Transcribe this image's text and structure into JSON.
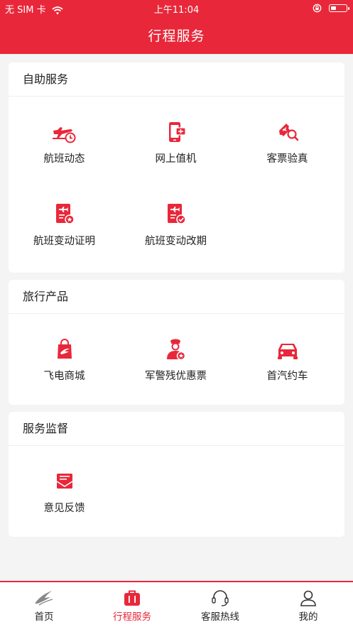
{
  "status_bar": {
    "carrier": "无 SIM 卡",
    "time": "上午11:04"
  },
  "header": {
    "title": "行程服务"
  },
  "sections": [
    {
      "title": "自助服务",
      "items": [
        {
          "label": "航班动态",
          "icon": "plane-clock-icon"
        },
        {
          "label": "网上值机",
          "icon": "phone-boarding-icon"
        },
        {
          "label": "客票验真",
          "icon": "ticket-search-icon"
        },
        {
          "label": "航班变动证明",
          "icon": "document-plane-star-icon"
        },
        {
          "label": "航班变动改期",
          "icon": "document-plane-check-icon"
        }
      ]
    },
    {
      "title": "旅行产品",
      "items": [
        {
          "label": "飞电商城",
          "icon": "shopping-bag-icon"
        },
        {
          "label": "军警残优惠票",
          "icon": "officer-badge-icon"
        },
        {
          "label": "首汽约车",
          "icon": "car-icon"
        }
      ]
    },
    {
      "title": "服务监督",
      "items": [
        {
          "label": "意见反馈",
          "icon": "feedback-envelope-icon"
        }
      ]
    }
  ],
  "tabbar": {
    "items": [
      {
        "label": "首页",
        "icon": "home-logo-icon",
        "active": false
      },
      {
        "label": "行程服务",
        "icon": "suitcase-icon",
        "active": true
      },
      {
        "label": "客服热线",
        "icon": "headset-icon",
        "active": false
      },
      {
        "label": "我的",
        "icon": "user-icon",
        "active": false
      }
    ]
  },
  "colors": {
    "brand": "#e8283a",
    "background": "#f4f4f4"
  }
}
